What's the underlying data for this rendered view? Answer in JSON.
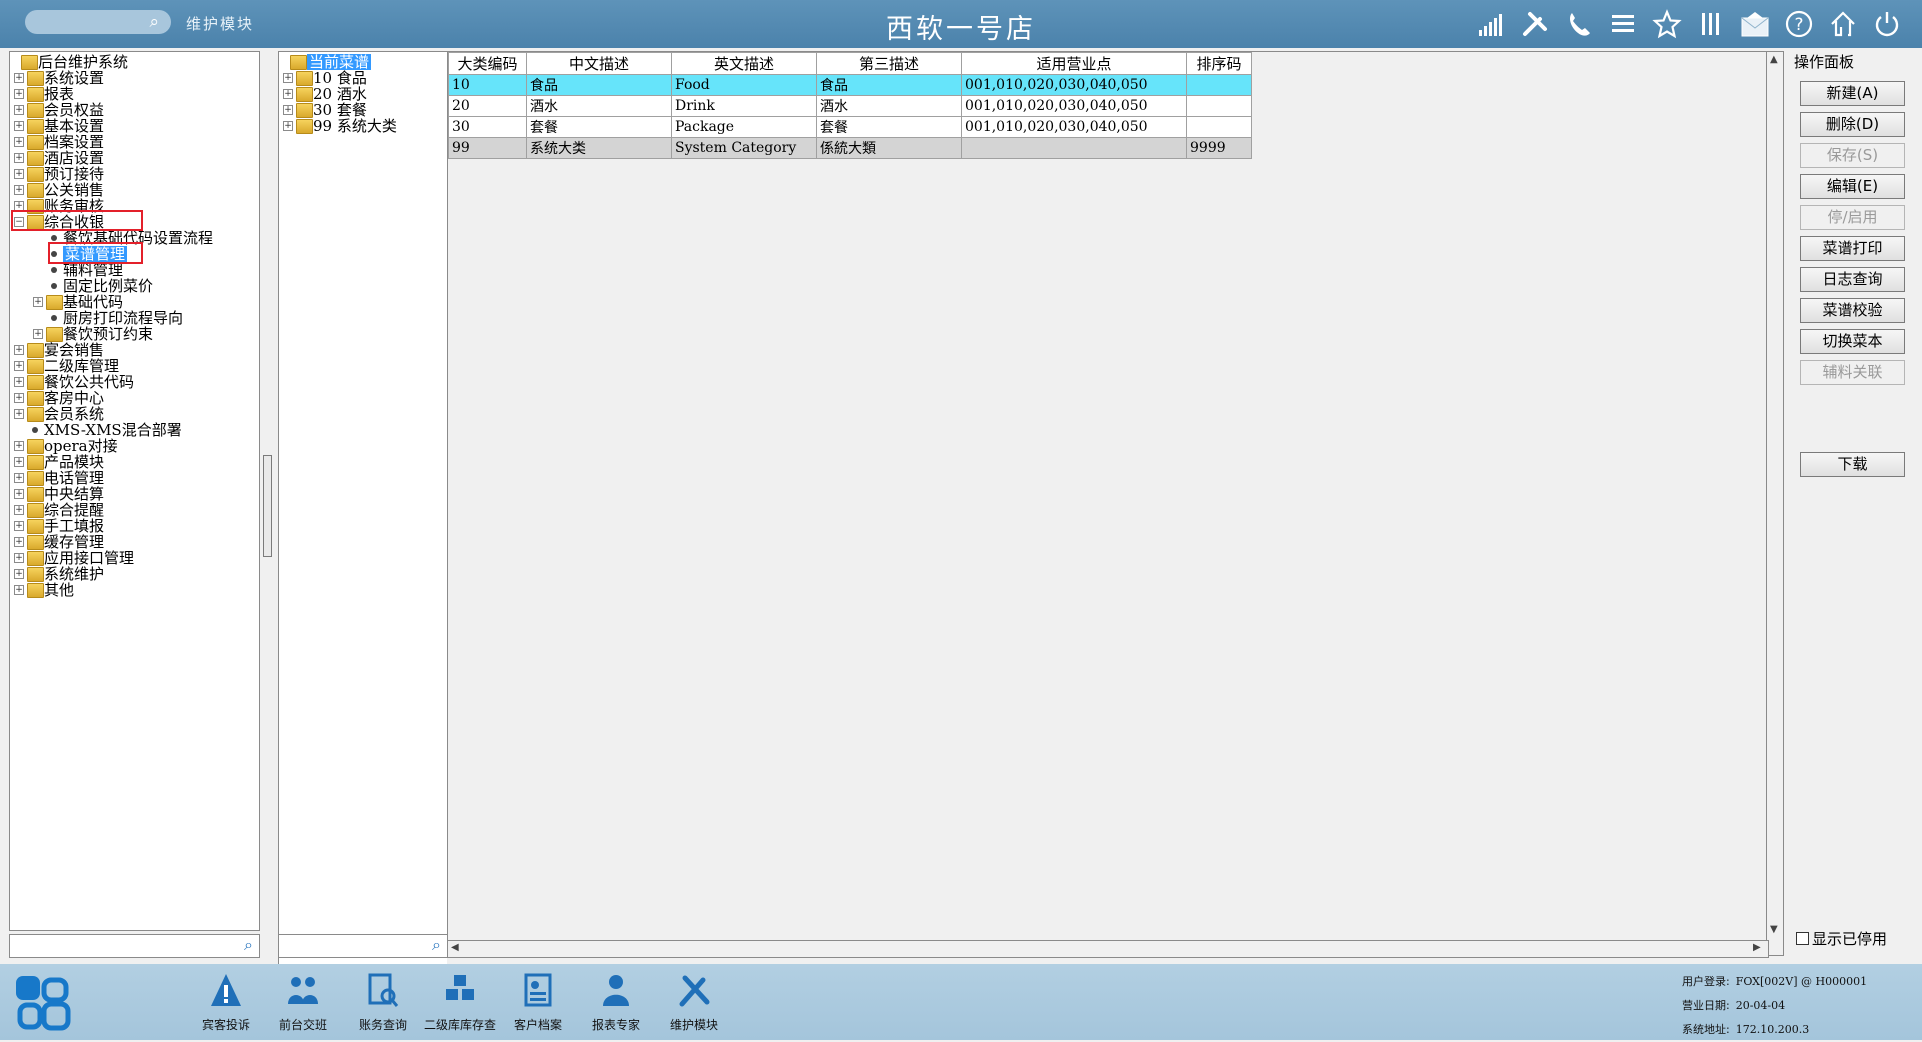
{
  "titlebar": {
    "module_label": "维护模块",
    "app_title": "西软一号店"
  },
  "tree_left": {
    "items": [
      {
        "label": "后台维护系统"
      },
      {
        "label": "系统设置"
      },
      {
        "label": "报表"
      },
      {
        "label": "会员权益"
      },
      {
        "label": "基本设置"
      },
      {
        "label": "档案设置"
      },
      {
        "label": "酒店设置"
      },
      {
        "label": "预订接待"
      },
      {
        "label": "公关销售"
      },
      {
        "label": "账务审核"
      },
      {
        "label": "综合收银"
      },
      {
        "label": "餐饮基础代码设置流程"
      },
      {
        "label": "菜谱管理"
      },
      {
        "label": "辅料管理"
      },
      {
        "label": "固定比例菜价"
      },
      {
        "label": "基础代码"
      },
      {
        "label": "厨房打印流程导向"
      },
      {
        "label": "餐饮预订约束"
      },
      {
        "label": "宴会销售"
      },
      {
        "label": "二级库管理"
      },
      {
        "label": "餐饮公共代码"
      },
      {
        "label": "客房中心"
      },
      {
        "label": "会员系统"
      },
      {
        "label": "XMS-XMS混合部署"
      },
      {
        "label": "opera对接"
      },
      {
        "label": "产品模块"
      },
      {
        "label": "电话管理"
      },
      {
        "label": "中央结算"
      },
      {
        "label": "综合提醒"
      },
      {
        "label": "手工填报"
      },
      {
        "label": "缓存管理"
      },
      {
        "label": "应用接口管理"
      },
      {
        "label": "系统维护"
      },
      {
        "label": "其他"
      }
    ]
  },
  "tree_mid": {
    "items": [
      {
        "label": "当前菜谱"
      },
      {
        "label": "10  食品"
      },
      {
        "label": "20  酒水"
      },
      {
        "label": "30  套餐"
      },
      {
        "label": "99  系统大类"
      }
    ]
  },
  "grid": {
    "columns": [
      "大类编码",
      "中文描述",
      "英文描述",
      "第三描述",
      "适用营业点",
      "排序码"
    ],
    "rows": [
      {
        "code": "10",
        "cn": "食品",
        "en": "Food",
        "third": "食品",
        "outlets": "001,010,020,030,040,050",
        "sort": ""
      },
      {
        "code": "20",
        "cn": "酒水",
        "en": "Drink",
        "third": "酒水",
        "outlets": "001,010,020,030,040,050",
        "sort": ""
      },
      {
        "code": "30",
        "cn": "套餐",
        "en": "Package",
        "third": "套餐",
        "outlets": "001,010,020,030,040,050",
        "sort": ""
      },
      {
        "code": "99",
        "cn": "系统大类",
        "en": "System Category",
        "third": "係統大類",
        "outlets": "",
        "sort": "9999"
      }
    ]
  },
  "ops": {
    "title": "操作面板",
    "buttons": {
      "new": "新建(A)",
      "delete": "删除(D)",
      "save": "保存(S)",
      "edit": "编辑(E)",
      "toggle": "停/启用",
      "print": "菜谱打印",
      "log": "日志查询",
      "verify": "菜谱校验",
      "switch": "切换菜本",
      "aux": "辅料关联",
      "download": "下载"
    },
    "show_disabled": "显示已停用"
  },
  "taskbar": {
    "items": [
      "宾客投诉",
      "前台交班",
      "账务查询",
      "二级库库存查",
      "客户档案",
      "报表专家",
      "维护模块"
    ]
  },
  "status": {
    "user_label": "用户登录:",
    "user_value": "FOX[002V] @ H000001",
    "date_label": "营业日期:",
    "date_value": "20-04-04",
    "addr_label": "系统地址:",
    "addr_value": "172.10.200.3"
  },
  "colors": {
    "titlebar": "#5289b2",
    "selection": "#3399ff",
    "row_highlight": "#66e4fa",
    "taskbar": "#a9c8dd",
    "accent_icon": "#2b7ac0"
  }
}
